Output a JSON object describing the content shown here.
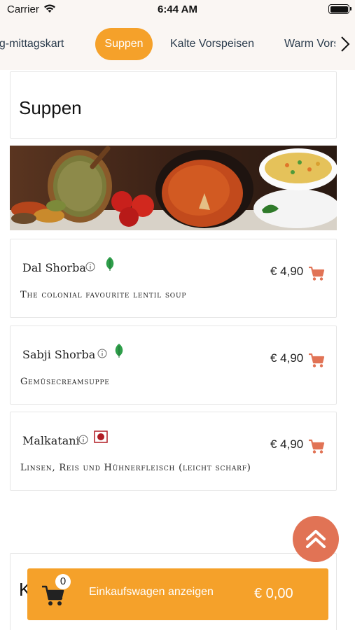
{
  "status_bar": {
    "carrier": "Carrier",
    "time": "6:44 AM"
  },
  "tabs": [
    {
      "label": "ag-mittagskart",
      "active": false
    },
    {
      "label": "Suppen",
      "active": true
    },
    {
      "label": "Kalte Vorspeisen",
      "active": false
    },
    {
      "label": "Warm Vorspeisen",
      "active": false
    }
  ],
  "section": {
    "title": "Suppen",
    "next_title": "K"
  },
  "dishes": [
    {
      "name": "Dal Shorba",
      "price": "€ 4,90",
      "description": "The colonial favourite lentil soup",
      "badge": "leaf-icon"
    },
    {
      "name": "Sabji Shorba",
      "price": "€ 4,90",
      "description": "Gemüsecreamsuppe",
      "badge": "leaf-icon"
    },
    {
      "name": "Malkatani",
      "price": "€ 4,90",
      "description": "Linsen, Reis und Hühnerfleisch (leicht scharf)",
      "badge": "chili-mark-icon"
    }
  ],
  "cart": {
    "count": "0",
    "label": "Einkaufswagen anzeigen",
    "total": "€ 0,00"
  },
  "colors": {
    "accent": "#f5a12a",
    "cart_icon": "#e17355",
    "fab": "#e17355",
    "leaf": "#2e9e4a",
    "chili": "#b01c24"
  }
}
